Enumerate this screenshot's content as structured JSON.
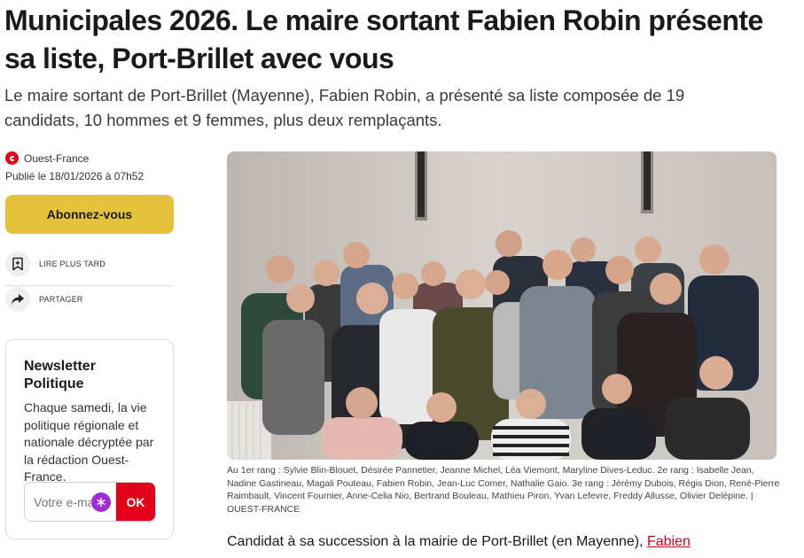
{
  "article": {
    "headline": "Municipales 2026. Le maire sortant Fabien Robin présente sa liste, Port-Brillet avec vous",
    "lead": "Le maire sortant de Port-Brillet (Mayenne), Fabien Robin, a présenté sa liste composée de 19 candidats, 10 hommes et 9 femmes, plus deux remplaçants.",
    "source": "Ouest-France",
    "published": "Publié le 18/01/2026 à 07h52",
    "photo_caption": "Au 1er rang : Sylvie Blin-Blouet, Désirée Pannetier, Jeanne Michel, Léa Viemont, Maryline Dives-Leduc. 2e rang : Isabelle Jean, Nadine Gastineau, Magali Pouteau, Fabien Robin, Jean-Luc Comer, Nathalie Gaio. 3e rang : Jérémy Dubois, Régis Dion, René-Pierre Raimbault, Vincent Fournier, Anne-Celia Nio, Bertrand Bouleau, Mathieu Piron, Yvan Lefevre, Freddy Allusse, Olivier Delépine. | OUEST-FRANCE",
    "body_start": "Candidat à sa succession à la mairie de Port-Brillet (en Mayenne), ",
    "body_link": "Fabien"
  },
  "sidebar": {
    "subscribe_label": "Abonnez-vous",
    "read_later_label": "LIRE PLUS TARD",
    "share_label": "PARTAGER",
    "read_later_icon": "bookmark-plus-icon",
    "share_icon": "share-arrow-icon"
  },
  "newsletter": {
    "title": "Newsletter Politique",
    "description": "Chaque samedi, la vie politique régionale et nationale décryptée par la rédaction Ouest-France.",
    "email_placeholder": "Votre e-mail",
    "submit_label": "OK"
  },
  "colors": {
    "brand_red": "#e2001a",
    "subscribe_yellow": "#e5c23a",
    "link_red": "#c8001a"
  }
}
